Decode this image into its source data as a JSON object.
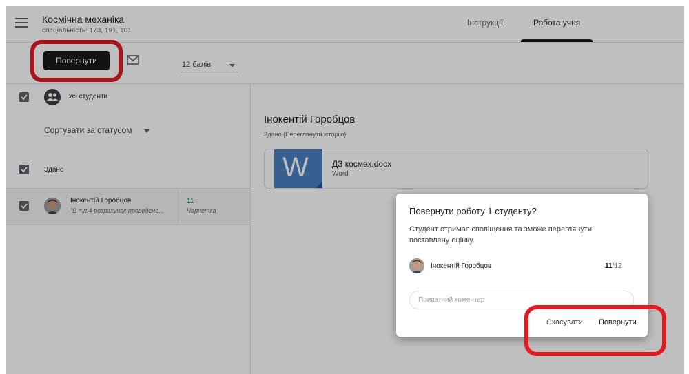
{
  "header": {
    "course_title": "Космічна механіка",
    "course_subtitle": "спеціальність: 173, 191, 101",
    "tabs": [
      {
        "label": "Інструкції",
        "active": false
      },
      {
        "label": "Робота учня",
        "active": true
      }
    ]
  },
  "toolbar": {
    "return_label": "Повернути",
    "points_value": "12 балів"
  },
  "left_panel": {
    "all_students_label": "Усі студенти",
    "sort_label": "Сортувати за статусом",
    "section_label": "Здано",
    "student": {
      "name": "Інокентій Горобцов",
      "comment": "\"В п.п.4 розрахунок проведено...",
      "score": "11",
      "status": "Чернетка"
    }
  },
  "main": {
    "student_name": "Інокентій Горобцов",
    "status_line": "Здано (Переглянути історію)",
    "attachment": {
      "icon": "W",
      "file_name": "ДЗ космех.docx",
      "file_type": "Word"
    }
  },
  "dialog": {
    "title": "Повернути роботу 1 студенту?",
    "text": "Студент отримає сповіщення та зможе переглянути поставлену оцінку.",
    "student_name": "Інокентій Горобцов",
    "score_value": "11",
    "score_max": "/12",
    "comment_placeholder": "Приватний коментар",
    "cancel_label": "Скасувати",
    "return_label": "Повернути"
  },
  "colors": {
    "highlight": "#e11b22",
    "primary_button": "#1a1a1a",
    "score_green": "#1e8e3e",
    "word_blue": "#4a7fc1"
  }
}
